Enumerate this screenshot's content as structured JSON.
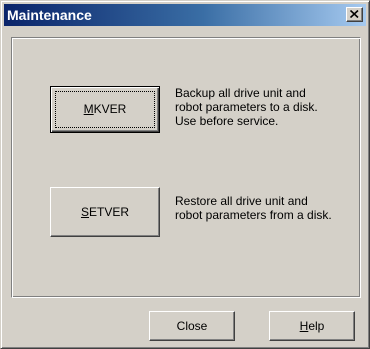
{
  "window": {
    "title": "Maintenance"
  },
  "actions": [
    {
      "label_mnemonic": "M",
      "label_rest": "KVER",
      "description": [
        "Backup all drive unit and",
        "robot parameters to a disk.",
        "Use before service."
      ]
    },
    {
      "label_mnemonic": "S",
      "label_rest": "ETVER",
      "description": [
        "Restore all drive unit and",
        "robot parameters from a disk."
      ]
    }
  ],
  "footer": {
    "close_label": "Close",
    "help_mnemonic": "H",
    "help_rest": "elp"
  },
  "colors": {
    "titlebar_start": "#0a246a",
    "titlebar_end": "#a6caf0",
    "face": "#d4d0c8"
  },
  "icons": {
    "close": "close-icon"
  }
}
